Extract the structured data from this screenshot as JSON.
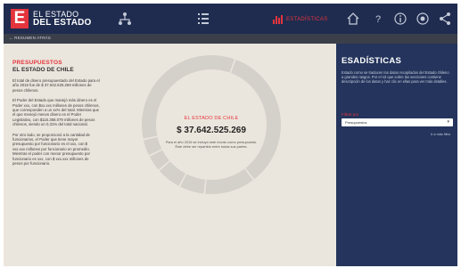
{
  "header": {
    "logo_letter": "E",
    "title_line1": "EL ESTADO",
    "title_line2": "DEL ESTADO",
    "active_nav_label": "ESTADÍSTICAS",
    "colors": {
      "bar": "#1f2c4f",
      "accent": "#e4343c"
    },
    "icons": [
      "org-chart-icon",
      "list-icon",
      "bar-chart-icon",
      "home-icon",
      "help-icon",
      "info-icon",
      "settings-icon",
      "share-icon"
    ]
  },
  "breadcrumb": {
    "label": "← RESUMEN ATRÁS"
  },
  "left_panel": {
    "heading": "PRESUPUESTOS",
    "subheading": "EL ESTADO DE CHILE",
    "paragraph1": "El total de dinero presupuestado del Estado para el año 2016 fue de $ 37.642.525.269 millones de pesos chilenos.",
    "paragraph2": "El Poder del Estado que manejó más dinero es el Poder xxx, con $xx.xxx millones de pesos chilenos, que corresponden a un xx% del total. Mientras que el que menejó menos dinero es el Poder Legislativo, con $115.358.079 millones de pesos chilenos, siendo un 0,31% del total nacional.",
    "paragraph3": "Por otro lado, se proporcionó a la cantidad de funcionarios, el Poder que tiene mayor presupuesto por funcionario es el xxx, con $ xxx.xxx millones por funcionario en promedio. Mientras el poder con menor presupuesto por funcionario es xxx, con $ xxx.xxx millones de pesos por funcionario."
  },
  "center": {
    "title": "EL ESTADO DE CHILE",
    "amount": "$ 37.642.525.269",
    "description": "Para el año 2016 se incluyó este monto como presupuesto. Éste debe ser repartido entre todas sus partes."
  },
  "sidebar": {
    "title": "ESADÍSTICAS",
    "text": "Estado como se traducen los datos recopilados del Estado chileno a grandes rasgos. Por el rol que sobre las secciones contiene descripción de los datos y haz clic en ellas para ver más detalles.",
    "filter_label": "Filtrar por",
    "select_value": "Presupuestos",
    "link": "Ir a más filtro"
  },
  "chart_data": {
    "type": "pie",
    "title": "",
    "segments": [
      {
        "value": 34
      },
      {
        "value": 12
      },
      {
        "value": 6
      },
      {
        "value": 6
      },
      {
        "value": 4
      },
      {
        "value": 4
      },
      {
        "value": 34
      }
    ]
  }
}
